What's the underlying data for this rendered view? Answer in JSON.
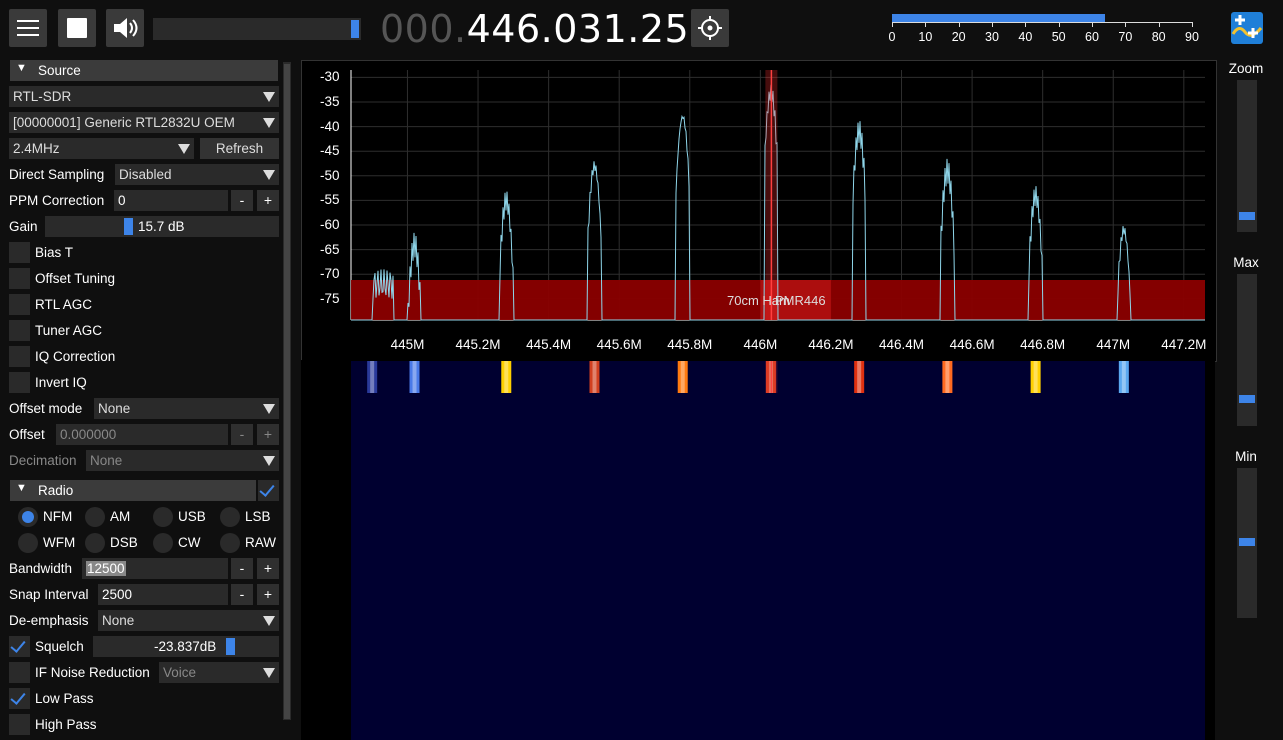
{
  "toolbar": {
    "frequency_dim": "000.",
    "frequency_main": "446.031.250",
    "volume_level": 1.0
  },
  "snr_meter": {
    "value": 64,
    "ticks": [
      "0",
      "10",
      "20",
      "30",
      "40",
      "50",
      "60",
      "70",
      "80",
      "90"
    ]
  },
  "source": {
    "header": "Source",
    "source_select": "RTL-SDR",
    "device_select": "[00000001] Generic RTL2832U OEM",
    "samplerate_select": "2.4MHz",
    "refresh_label": "Refresh",
    "direct_sampling_label": "Direct Sampling",
    "direct_sampling_value": "Disabled",
    "ppm_label": "PPM Correction",
    "ppm_value": "0",
    "gain_label": "Gain",
    "gain_value": "15.7 dB",
    "gain_level": 0.35,
    "checkboxes": [
      {
        "label": "Bias T",
        "checked": false
      },
      {
        "label": "Offset Tuning",
        "checked": false
      },
      {
        "label": "RTL AGC",
        "checked": false
      },
      {
        "label": "Tuner AGC",
        "checked": false
      },
      {
        "label": "IQ Correction",
        "checked": false
      },
      {
        "label": "Invert IQ",
        "checked": false
      }
    ],
    "offset_mode_label": "Offset mode",
    "offset_mode_value": "None",
    "offset_label": "Offset",
    "offset_value": "0.000000",
    "decimation_label": "Decimation",
    "decimation_value": "None",
    "minus": "-",
    "plus": "+"
  },
  "radio": {
    "header": "Radio",
    "modes": [
      "NFM",
      "AM",
      "USB",
      "LSB",
      "WFM",
      "DSB",
      "CW",
      "RAW"
    ],
    "selected_mode": "NFM",
    "bandwidth_label": "Bandwidth",
    "bandwidth_value": "12500",
    "snap_label": "Snap Interval",
    "snap_value": "2500",
    "deemph_label": "De-emphasis",
    "deemph_value": "None",
    "squelch_label": "Squelch",
    "squelch_value": "-23.837dB",
    "squelch_checked": true,
    "ifnr_label": "IF Noise Reduction",
    "ifnr_value": "Voice",
    "lowpass_label": "Low Pass",
    "lowpass_checked": true,
    "highpass_label": "High Pass",
    "highpass_checked": false
  },
  "fft": {
    "y_labels": [
      "-30",
      "-35",
      "-40",
      "-45",
      "-50",
      "-55",
      "-60",
      "-65",
      "-70",
      "-75"
    ],
    "x_labels": [
      "445M",
      "445.2M",
      "445.4M",
      "445.6M",
      "445.8M",
      "446M",
      "446.2M",
      "446.4M",
      "446.6M",
      "446.8M",
      "447M",
      "447.2M"
    ],
    "bandplan_label_1": "70cm Ham",
    "bandplan_label_2": "PMR446",
    "peak_freqs_mhz": [
      445.02,
      445.28,
      445.53,
      445.78,
      446.03,
      446.28,
      446.53,
      446.78,
      447.03
    ],
    "peak_levels_db": [
      -64,
      -55,
      -48,
      -38,
      -33,
      -41,
      -49,
      -54,
      -61
    ]
  },
  "right_panel": {
    "zoom_label": "Zoom",
    "zoom_level": 0.07,
    "max_label": "Max",
    "max_level": 0.15,
    "min_label": "Min",
    "min_level": 0.5
  },
  "colors": {
    "accent": "#3d84e8",
    "trace": "#8fd6ea",
    "band": "#8b0000",
    "waterfall": "#000030"
  }
}
